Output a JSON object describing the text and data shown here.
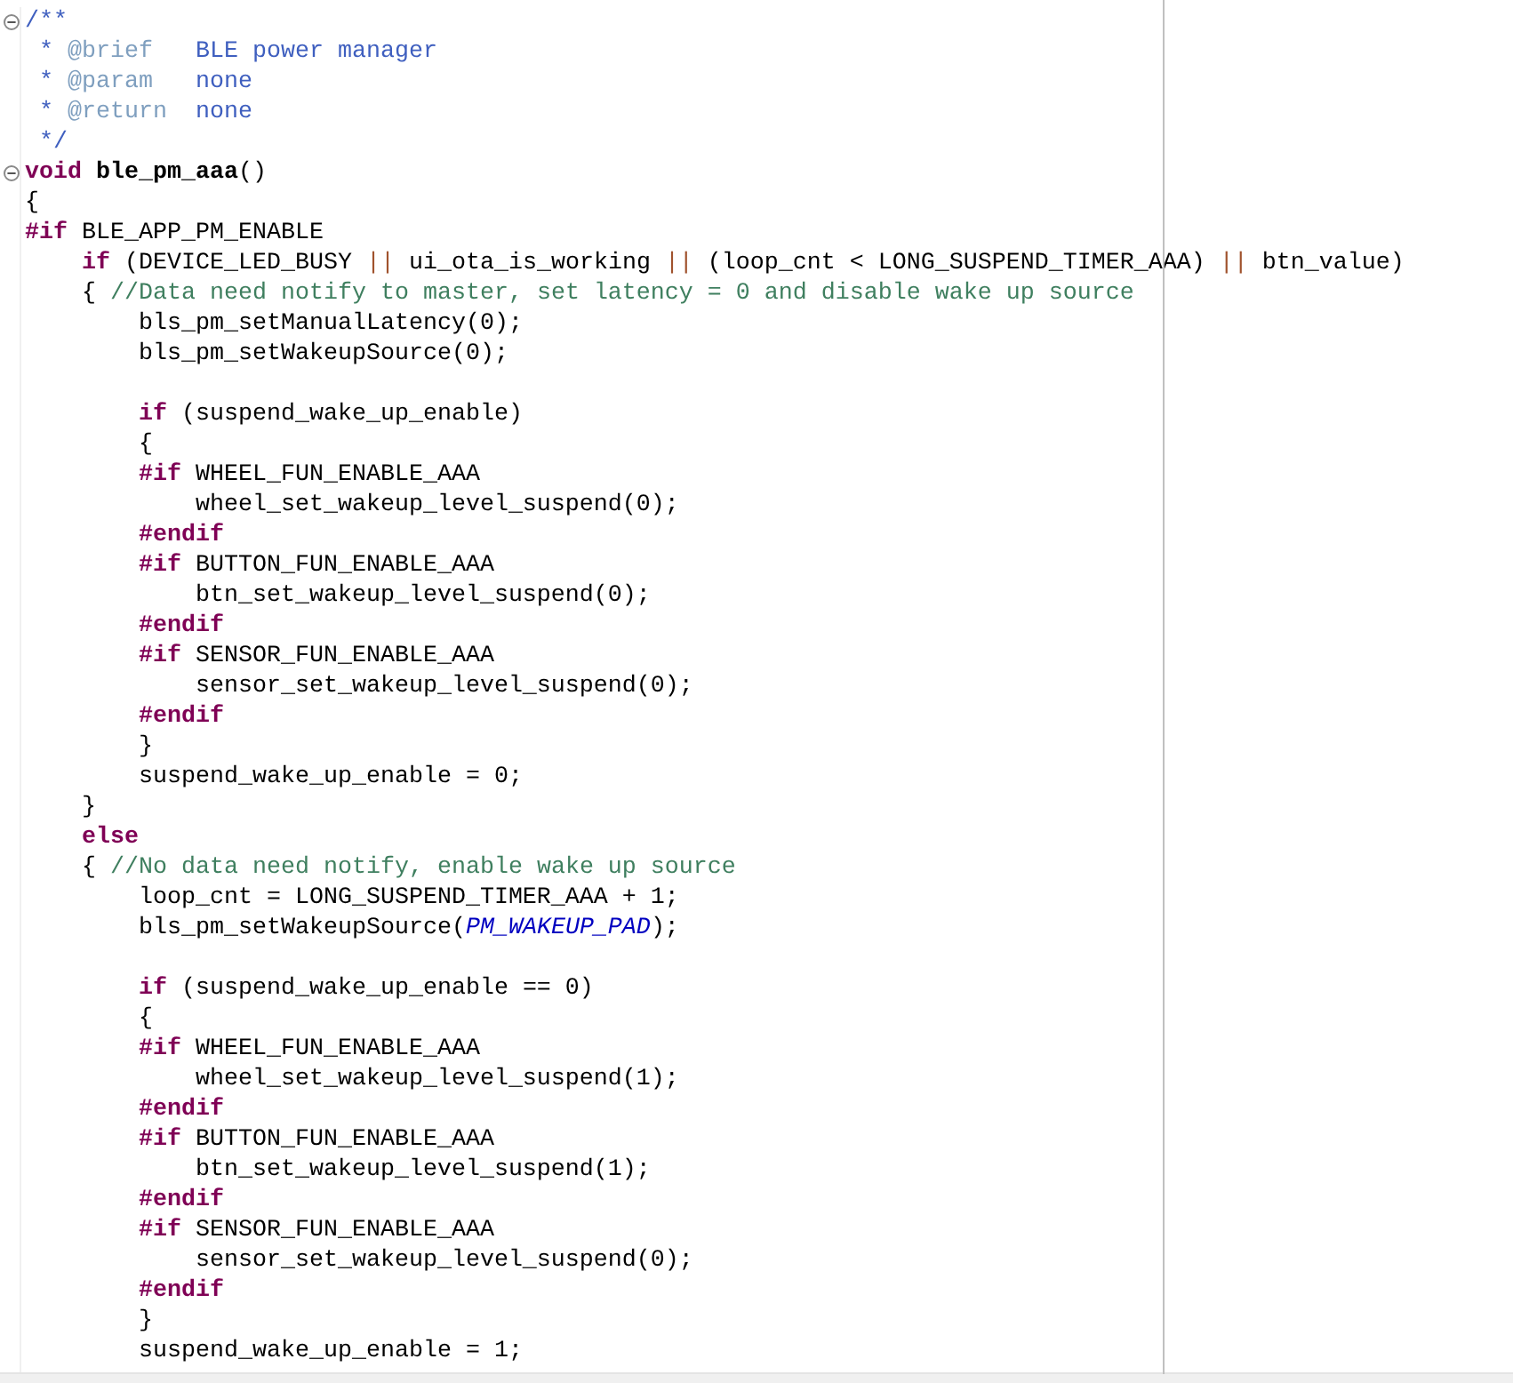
{
  "editor": {
    "lines": [
      {
        "fold": true,
        "tokens": [
          {
            "kind": "doc",
            "text": "/**"
          }
        ]
      },
      {
        "fold": false,
        "tokens": [
          {
            "kind": "doc",
            "text": " * "
          },
          {
            "kind": "tag",
            "text": "@brief"
          },
          {
            "kind": "doc",
            "text": "   BLE power manager"
          }
        ]
      },
      {
        "fold": false,
        "tokens": [
          {
            "kind": "doc",
            "text": " * "
          },
          {
            "kind": "tag",
            "text": "@param"
          },
          {
            "kind": "doc",
            "text": "   none"
          }
        ]
      },
      {
        "fold": false,
        "tokens": [
          {
            "kind": "doc",
            "text": " * "
          },
          {
            "kind": "tag",
            "text": "@return"
          },
          {
            "kind": "doc",
            "text": "  none"
          }
        ]
      },
      {
        "fold": false,
        "tokens": [
          {
            "kind": "doc",
            "text": " */"
          }
        ]
      },
      {
        "fold": true,
        "tokens": [
          {
            "kind": "keyword",
            "text": "void"
          },
          {
            "kind": "bold",
            "text": " ble_pm_aaa"
          },
          {
            "kind": "plain",
            "text": "()"
          }
        ]
      },
      {
        "fold": false,
        "tokens": [
          {
            "kind": "plain",
            "text": "{"
          }
        ]
      },
      {
        "fold": false,
        "tokens": [
          {
            "kind": "directive",
            "text": "#if"
          },
          {
            "kind": "plain",
            "text": " BLE_APP_PM_ENABLE"
          }
        ]
      },
      {
        "fold": false,
        "tokens": [
          {
            "kind": "keyword",
            "text": "    if"
          },
          {
            "kind": "plain",
            "text": " (DEVICE_LED_BUSY "
          },
          {
            "kind": "operator",
            "text": "||"
          },
          {
            "kind": "plain",
            "text": " ui_ota_is_working "
          },
          {
            "kind": "operator",
            "text": "||"
          },
          {
            "kind": "plain",
            "text": " (loop_cnt < LONG_SUSPEND_TIMER_AAA) "
          },
          {
            "kind": "operator",
            "text": "||"
          },
          {
            "kind": "plain",
            "text": " btn_value)"
          }
        ]
      },
      {
        "fold": false,
        "tokens": [
          {
            "kind": "plain",
            "text": "    { "
          },
          {
            "kind": "comment",
            "text": "//Data need notify to master, set latency = 0 and disable wake up source"
          }
        ]
      },
      {
        "fold": false,
        "tokens": [
          {
            "kind": "plain",
            "text": "        bls_pm_setManualLatency(0);"
          }
        ]
      },
      {
        "fold": false,
        "tokens": [
          {
            "kind": "plain",
            "text": "        bls_pm_setWakeupSource(0);"
          }
        ]
      },
      {
        "fold": false
      },
      {
        "fold": false,
        "tokens": [
          {
            "kind": "keyword",
            "text": "        if"
          },
          {
            "kind": "plain",
            "text": " (suspend_wake_up_enable)"
          }
        ]
      },
      {
        "fold": false,
        "tokens": [
          {
            "kind": "plain",
            "text": "        {"
          }
        ]
      },
      {
        "fold": false,
        "tokens": [
          {
            "kind": "directive",
            "text": "        #if"
          },
          {
            "kind": "plain",
            "text": " WHEEL_FUN_ENABLE_AAA"
          }
        ]
      },
      {
        "fold": false,
        "tokens": [
          {
            "kind": "plain",
            "text": "            wheel_set_wakeup_level_suspend(0);"
          }
        ]
      },
      {
        "fold": false,
        "tokens": [
          {
            "kind": "directive",
            "text": "        #endif"
          }
        ]
      },
      {
        "fold": false,
        "tokens": [
          {
            "kind": "directive",
            "text": "        #if"
          },
          {
            "kind": "plain",
            "text": " BUTTON_FUN_ENABLE_AAA"
          }
        ]
      },
      {
        "fold": false,
        "tokens": [
          {
            "kind": "plain",
            "text": "            btn_set_wakeup_level_suspend(0);"
          }
        ]
      },
      {
        "fold": false,
        "tokens": [
          {
            "kind": "directive",
            "text": "        #endif"
          }
        ]
      },
      {
        "fold": false,
        "tokens": [
          {
            "kind": "directive",
            "text": "        #if"
          },
          {
            "kind": "plain",
            "text": " SENSOR_FUN_ENABLE_AAA"
          }
        ]
      },
      {
        "fold": false,
        "tokens": [
          {
            "kind": "plain",
            "text": "            sensor_set_wakeup_level_suspend(0);"
          }
        ]
      },
      {
        "fold": false,
        "tokens": [
          {
            "kind": "directive",
            "text": "        #endif"
          }
        ]
      },
      {
        "fold": false,
        "tokens": [
          {
            "kind": "plain",
            "text": "        }"
          }
        ]
      },
      {
        "fold": false,
        "tokens": [
          {
            "kind": "plain",
            "text": "        suspend_wake_up_enable = 0;"
          }
        ]
      },
      {
        "fold": false,
        "tokens": [
          {
            "kind": "plain",
            "text": "    }"
          }
        ]
      },
      {
        "fold": false,
        "tokens": [
          {
            "kind": "keyword",
            "text": "    else"
          }
        ]
      },
      {
        "fold": false,
        "tokens": [
          {
            "kind": "plain",
            "text": "    { "
          },
          {
            "kind": "comment",
            "text": "//No data need notify, enable wake up source"
          }
        ]
      },
      {
        "fold": false,
        "tokens": [
          {
            "kind": "plain",
            "text": "        loop_cnt = LONG_SUSPEND_TIMER_AAA + 1;"
          }
        ]
      },
      {
        "fold": false,
        "tokens": [
          {
            "kind": "plain",
            "text": "        bls_pm_setWakeupSource("
          },
          {
            "kind": "macro",
            "text": "PM_WAKEUP_PAD"
          },
          {
            "kind": "plain",
            "text": ");"
          }
        ]
      },
      {
        "fold": false
      },
      {
        "fold": false,
        "tokens": [
          {
            "kind": "keyword",
            "text": "        if"
          },
          {
            "kind": "plain",
            "text": " (suspend_wake_up_enable == 0)"
          }
        ]
      },
      {
        "fold": false,
        "tokens": [
          {
            "kind": "plain",
            "text": "        {"
          }
        ]
      },
      {
        "fold": false,
        "tokens": [
          {
            "kind": "directive",
            "text": "        #if"
          },
          {
            "kind": "plain",
            "text": " WHEEL_FUN_ENABLE_AAA"
          }
        ]
      },
      {
        "fold": false,
        "tokens": [
          {
            "kind": "plain",
            "text": "            wheel_set_wakeup_level_suspend(1);"
          }
        ]
      },
      {
        "fold": false,
        "tokens": [
          {
            "kind": "directive",
            "text": "        #endif"
          }
        ]
      },
      {
        "fold": false,
        "tokens": [
          {
            "kind": "directive",
            "text": "        #if"
          },
          {
            "kind": "plain",
            "text": " BUTTON_FUN_ENABLE_AAA"
          }
        ]
      },
      {
        "fold": false,
        "tokens": [
          {
            "kind": "plain",
            "text": "            btn_set_wakeup_level_suspend(1);"
          }
        ]
      },
      {
        "fold": false,
        "tokens": [
          {
            "kind": "directive",
            "text": "        #endif"
          }
        ]
      },
      {
        "fold": false,
        "tokens": [
          {
            "kind": "directive",
            "text": "        #if"
          },
          {
            "kind": "plain",
            "text": " SENSOR_FUN_ENABLE_AAA"
          }
        ]
      },
      {
        "fold": false,
        "tokens": [
          {
            "kind": "plain",
            "text": "            sensor_set_wakeup_level_suspend(0);"
          }
        ]
      },
      {
        "fold": false,
        "tokens": [
          {
            "kind": "directive",
            "text": "        #endif"
          }
        ]
      },
      {
        "fold": false,
        "tokens": [
          {
            "kind": "plain",
            "text": "        }"
          }
        ]
      },
      {
        "fold": false,
        "tokens": [
          {
            "kind": "plain",
            "text": "        suspend_wake_up_enable = 1;"
          }
        ]
      }
    ]
  }
}
